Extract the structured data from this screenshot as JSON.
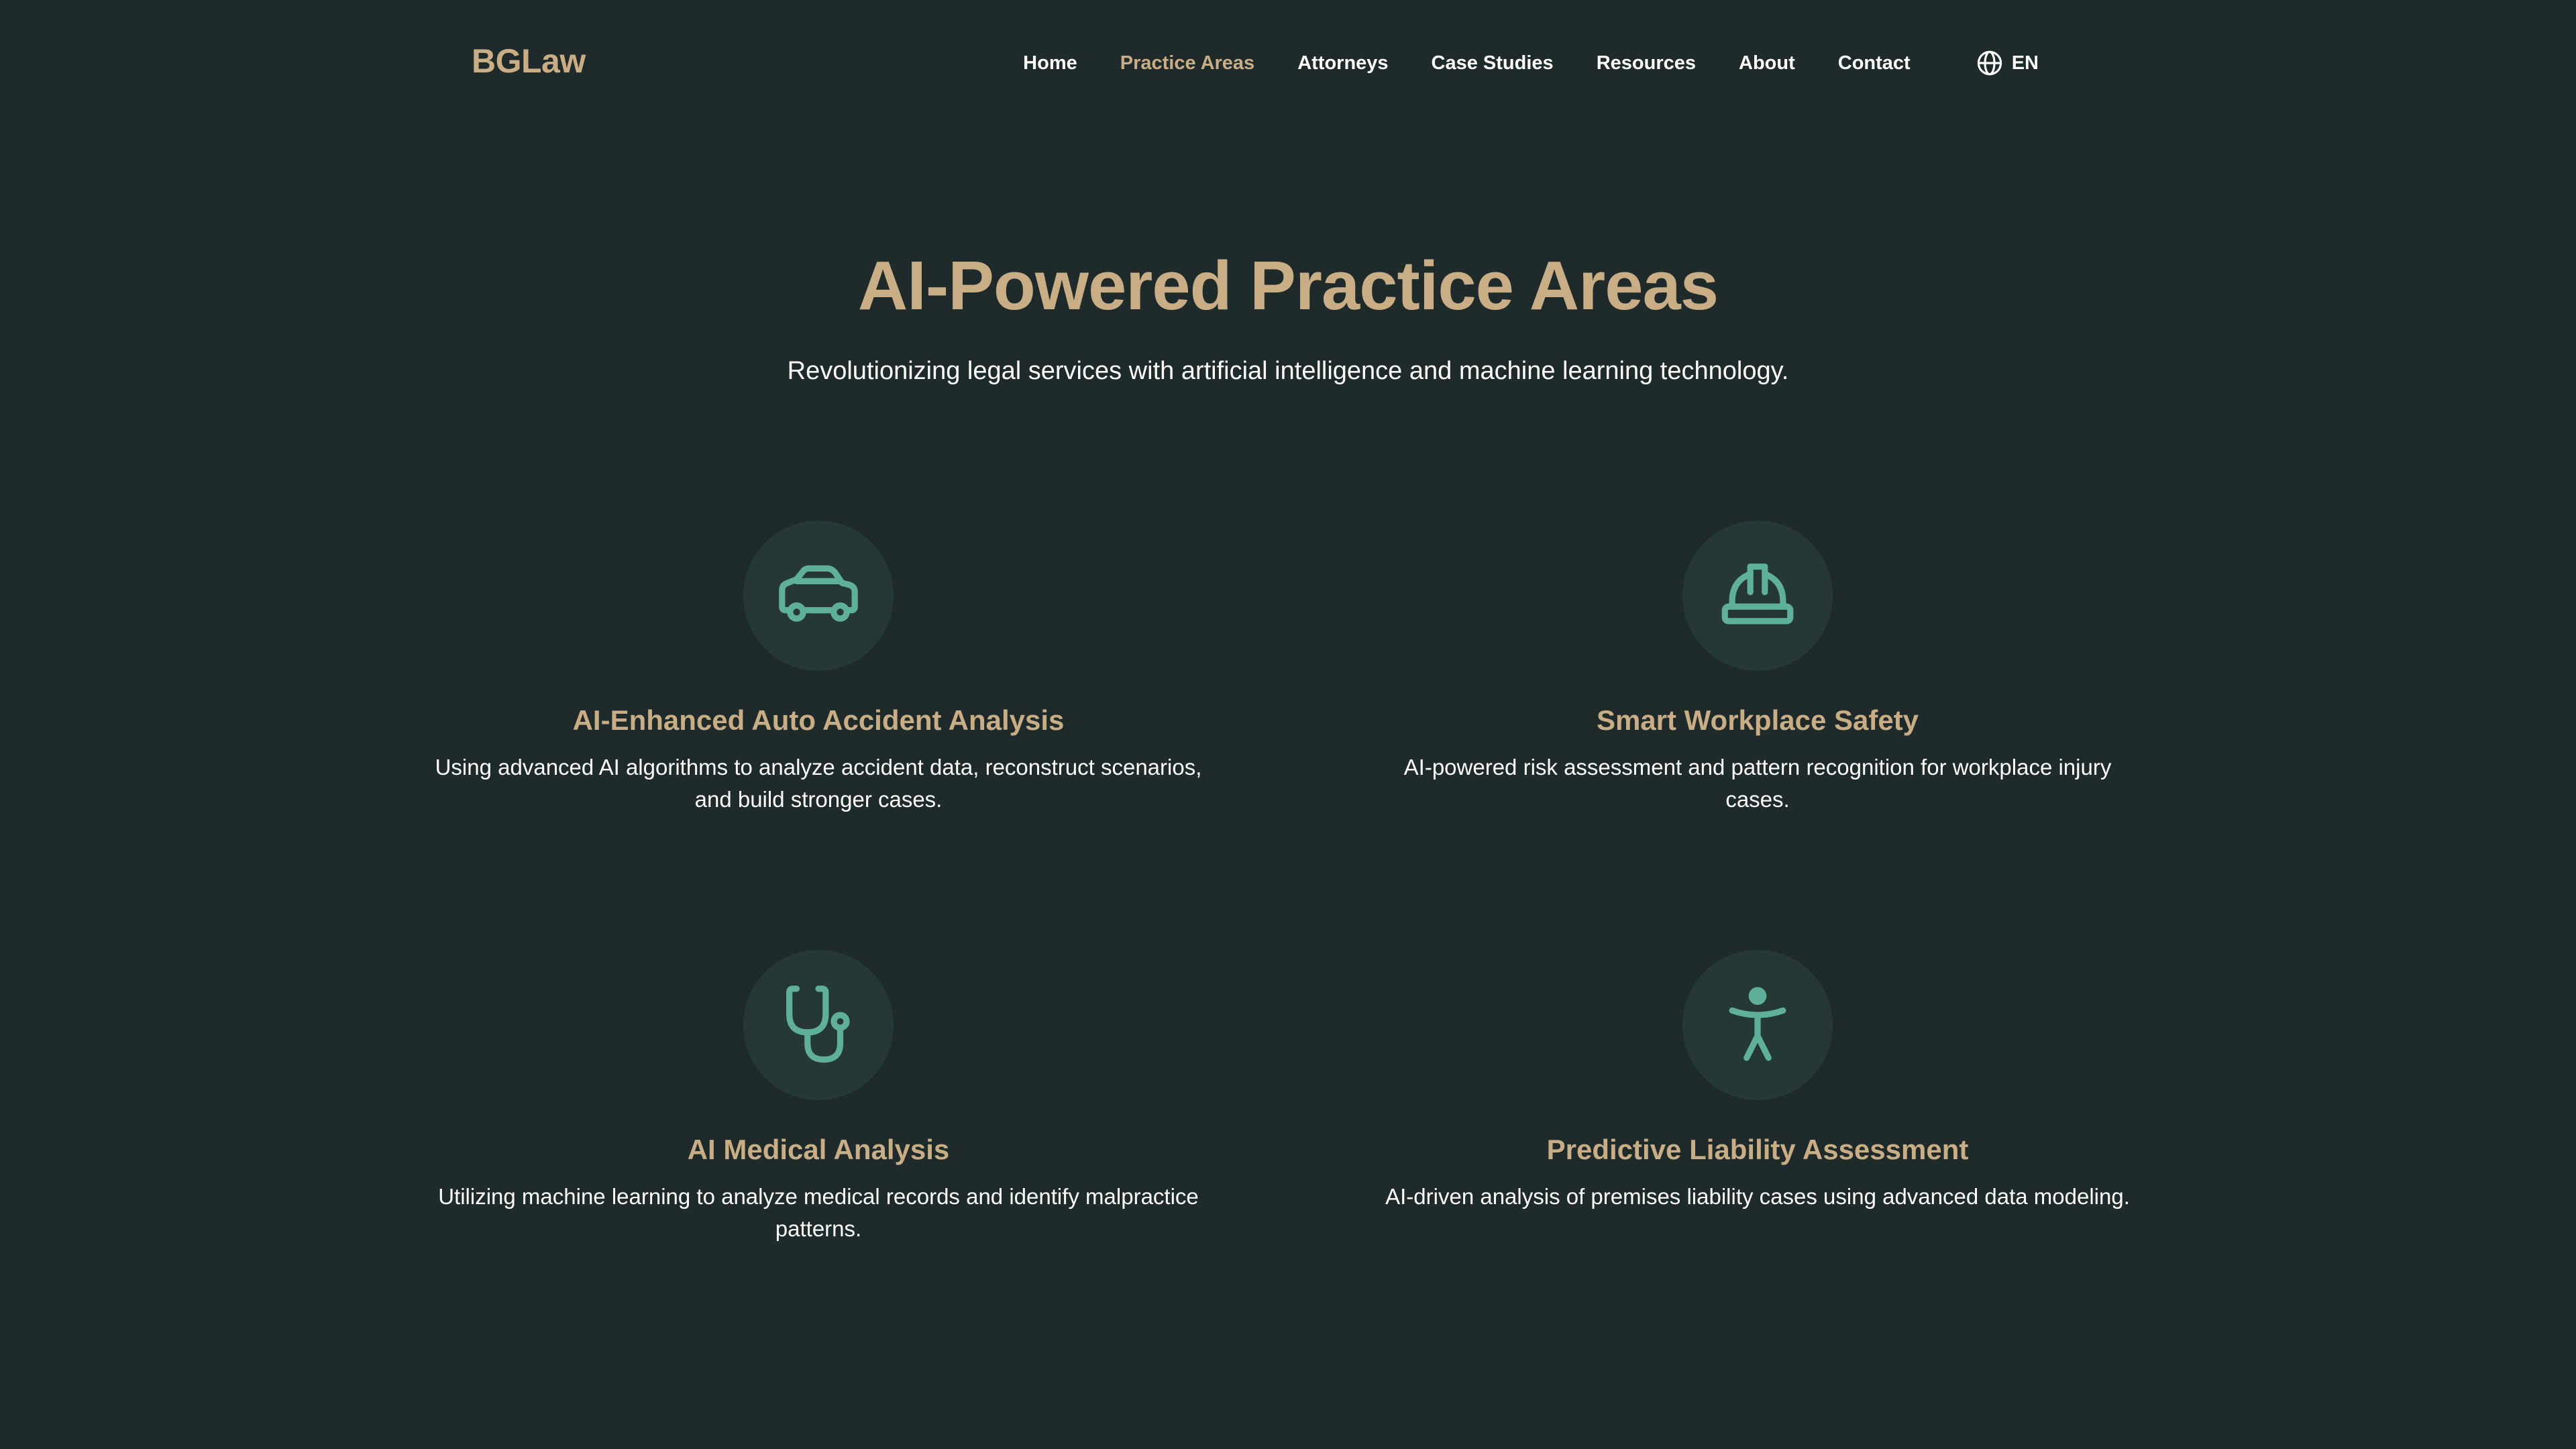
{
  "nav": {
    "logo": "BGLaw",
    "items": [
      {
        "label": "Home"
      },
      {
        "label": "Practice Areas",
        "active": true
      },
      {
        "label": "Attorneys"
      },
      {
        "label": "Case Studies"
      },
      {
        "label": "Resources"
      },
      {
        "label": "About"
      },
      {
        "label": "Contact"
      }
    ],
    "language": {
      "label": "EN",
      "icon": "globe-icon"
    }
  },
  "hero": {
    "title": "AI-Powered Practice Areas",
    "subtitle": "Revolutionizing legal services with artificial intelligence and machine learning technology."
  },
  "practice_areas": [
    {
      "icon": "car-icon",
      "title": "AI-Enhanced Auto Accident Analysis",
      "description": "Using advanced AI algorithms to analyze accident data, reconstruct scenarios, and build stronger cases."
    },
    {
      "icon": "hard-hat-icon",
      "title": "Smart Workplace Safety",
      "description": "AI-powered risk assessment and pattern recognition for workplace injury cases."
    },
    {
      "icon": "stethoscope-icon",
      "title": "AI Medical Analysis",
      "description": "Utilizing machine learning to analyze medical records and identify malpractice patterns."
    },
    {
      "icon": "person-icon",
      "title": "Predictive Liability Assessment",
      "description": "AI-driven analysis of premises liability cases using advanced data modeling."
    }
  ],
  "colors": {
    "background": "#1f2a2a",
    "accent_gold": "#c9ae85",
    "icon_teal": "#5fb09b",
    "icon_circle": "#263835",
    "text": "#ffffff"
  }
}
